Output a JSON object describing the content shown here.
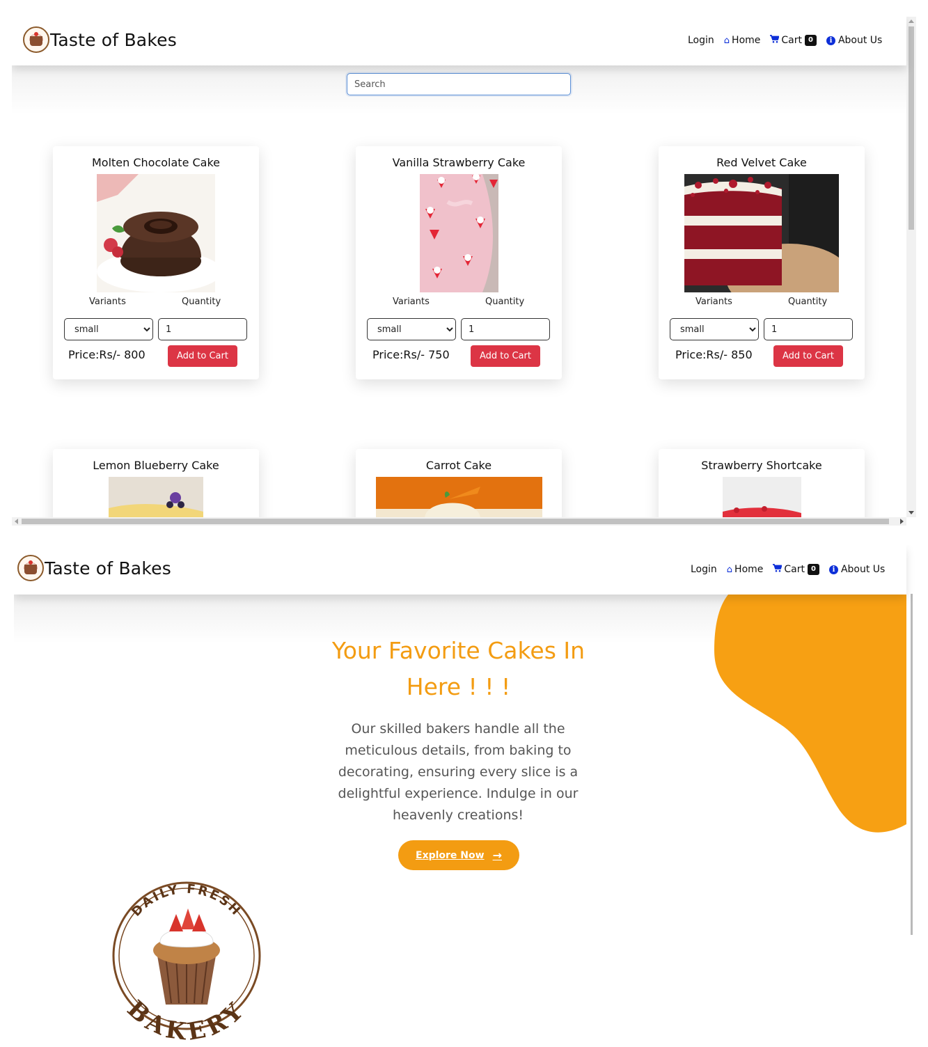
{
  "brand": {
    "name": "Taste of Bakes"
  },
  "nav": {
    "login": "Login",
    "home": "Home",
    "cart": "Cart",
    "cart_count": "0",
    "about": "About Us"
  },
  "search": {
    "placeholder": "Search"
  },
  "products": [
    {
      "title": "Molten Chocolate Cake",
      "variants_label": "Variants",
      "quantity_label": "Quantity",
      "variant": "small",
      "quantity": "1",
      "price": "Price:Rs/- 800",
      "button": "Add to Cart"
    },
    {
      "title": "Vanilla Strawberry Cake",
      "variants_label": "Variants",
      "quantity_label": "Quantity",
      "variant": "small",
      "quantity": "1",
      "price": "Price:Rs/- 750",
      "button": "Add to Cart"
    },
    {
      "title": "Red Velvet Cake",
      "variants_label": "Variants",
      "quantity_label": "Quantity",
      "variant": "small",
      "quantity": "1",
      "price": "Price:Rs/- 850",
      "button": "Add to Cart"
    },
    {
      "title": "Lemon Blueberry Cake"
    },
    {
      "title": "Carrot Cake"
    },
    {
      "title": "Strawberry Shortcake"
    }
  ],
  "hero": {
    "title": "Your Favorite Cakes In Here ! ! !",
    "text": "Our skilled bakers handle all the meticulous details, from baking to decorating, ensuring every slice is a delightful experience. Indulge in our heavenly creations!",
    "button": "Explore Now"
  },
  "logo_badge": {
    "top_text": "DAILY FRESH",
    "bottom_text": "BAKERY"
  },
  "colors": {
    "accent": "#f39c12",
    "button_red": "#dc3545",
    "nav_icon": "#0d2fd8"
  },
  "icons": {
    "home": "home-icon",
    "cart": "cart-icon",
    "about": "info-icon",
    "explore": "arrow-right-icon"
  }
}
